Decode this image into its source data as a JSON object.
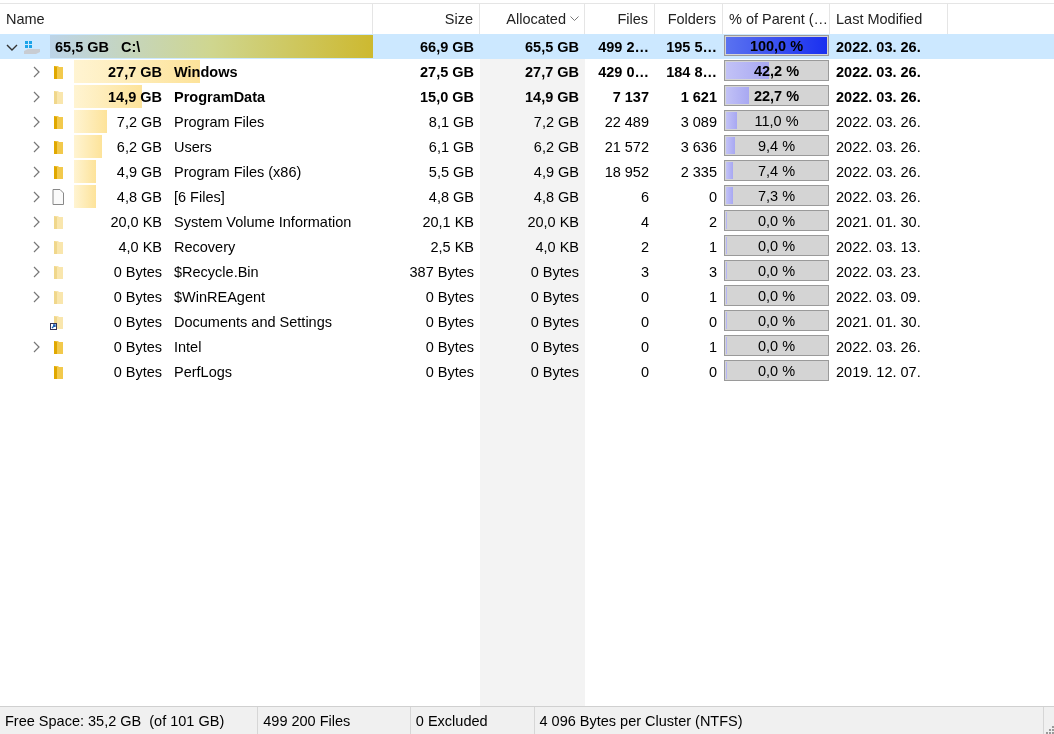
{
  "columns": [
    {
      "label": "Name",
      "sorted": false
    },
    {
      "label": "Size",
      "sorted": false
    },
    {
      "label": "Allocated",
      "sorted": true
    },
    {
      "label": "Files",
      "sorted": false
    },
    {
      "label": "Folders",
      "sorted": false
    },
    {
      "label": "% of Parent (…",
      "sorted": false
    },
    {
      "label": "Last Modified",
      "sorted": false
    }
  ],
  "tree": [
    {
      "kind": "drive",
      "name": "C:\\",
      "bar_label": "65,5 GB",
      "size": "66,9 GB",
      "allocated": "65,5 GB",
      "files": "499 2…",
      "folders": "195 5…",
      "percent": "100,0 %",
      "level": 1.0,
      "modified": "2022. 03. 26.",
      "bold": true,
      "hidden": false,
      "selected": true,
      "expandable": true,
      "expanded": true,
      "children": [
        {
          "kind": "folder",
          "name": "Windows",
          "bar_label": "27,7 GB",
          "size": "27,5 GB",
          "allocated": "27,7 GB",
          "files": "429 0…",
          "folders": "184 8…",
          "percent": "42,2 %",
          "level": 0.422,
          "modified": "2022. 03. 26.",
          "bold": true,
          "hidden": false,
          "selected": false,
          "expandable": true,
          "expanded": false
        },
        {
          "kind": "folder",
          "name": "ProgramData",
          "bar_label": "14,9 GB",
          "size": "15,0 GB",
          "allocated": "14,9 GB",
          "files": "7 137",
          "folders": "1 621",
          "percent": "22,7 %",
          "level": 0.227,
          "modified": "2022. 03. 26.",
          "bold": true,
          "hidden": true,
          "selected": false,
          "expandable": true,
          "expanded": false
        },
        {
          "kind": "folder",
          "name": "Program Files",
          "bar_label": "7,2 GB",
          "size": "8,1 GB",
          "allocated": "7,2 GB",
          "files": "22 489",
          "folders": "3 089",
          "percent": "11,0 %",
          "level": 0.11,
          "modified": "2022. 03. 26.",
          "bold": false,
          "hidden": false,
          "selected": false,
          "expandable": true,
          "expanded": false
        },
        {
          "kind": "folder",
          "name": "Users",
          "bar_label": "6,2 GB",
          "size": "6,1 GB",
          "allocated": "6,2 GB",
          "files": "21 572",
          "folders": "3 636",
          "percent": "9,4 %",
          "level": 0.094,
          "modified": "2022. 03. 26.",
          "bold": false,
          "hidden": false,
          "selected": false,
          "expandable": true,
          "expanded": false
        },
        {
          "kind": "folder",
          "name": "Program Files (x86)",
          "bar_label": "4,9 GB",
          "size": "5,5 GB",
          "allocated": "4,9 GB",
          "files": "18 952",
          "folders": "2 335",
          "percent": "7,4 %",
          "level": 0.074,
          "modified": "2022. 03. 26.",
          "bold": false,
          "hidden": false,
          "selected": false,
          "expandable": true,
          "expanded": false
        },
        {
          "kind": "file",
          "name": "[6 Files]",
          "bar_label": "4,8 GB",
          "size": "4,8 GB",
          "allocated": "4,8 GB",
          "files": "6",
          "folders": "0",
          "percent": "7,3 %",
          "level": 0.073,
          "modified": "2022. 03. 26.",
          "bold": false,
          "hidden": false,
          "selected": false,
          "expandable": true,
          "expanded": false
        },
        {
          "kind": "folder",
          "name": "System Volume Information",
          "bar_label": "20,0 KB",
          "size": "20,1 KB",
          "allocated": "20,0 KB",
          "files": "4",
          "folders": "2",
          "percent": "0,0 %",
          "level": 0.0,
          "modified": "2021. 01. 30.",
          "bold": false,
          "hidden": true,
          "selected": false,
          "expandable": true,
          "expanded": false
        },
        {
          "kind": "folder",
          "name": "Recovery",
          "bar_label": "4,0 KB",
          "size": "2,5 KB",
          "allocated": "4,0 KB",
          "files": "2",
          "folders": "1",
          "percent": "0,0 %",
          "level": 0.0,
          "modified": "2022. 03. 13.",
          "bold": false,
          "hidden": true,
          "selected": false,
          "expandable": true,
          "expanded": false
        },
        {
          "kind": "folder",
          "name": "$Recycle.Bin",
          "bar_label": "0 Bytes",
          "size": "387 Bytes",
          "allocated": "0 Bytes",
          "files": "3",
          "folders": "3",
          "percent": "0,0 %",
          "level": 0.0,
          "modified": "2022. 03. 23.",
          "bold": false,
          "hidden": true,
          "selected": false,
          "expandable": true,
          "expanded": false
        },
        {
          "kind": "folder",
          "name": "$WinREAgent",
          "bar_label": "0 Bytes",
          "size": "0 Bytes",
          "allocated": "0 Bytes",
          "files": "0",
          "folders": "1",
          "percent": "0,0 %",
          "level": 0.0,
          "modified": "2022. 03. 09.",
          "bold": false,
          "hidden": true,
          "selected": false,
          "expandable": true,
          "expanded": false
        },
        {
          "kind": "shortcut",
          "name": "Documents and Settings",
          "bar_label": "0 Bytes",
          "size": "0 Bytes",
          "allocated": "0 Bytes",
          "files": "0",
          "folders": "0",
          "percent": "0,0 %",
          "level": 0.0,
          "modified": "2021. 01. 30.",
          "bold": false,
          "hidden": true,
          "selected": false,
          "expandable": false,
          "expanded": false
        },
        {
          "kind": "folder",
          "name": "Intel",
          "bar_label": "0 Bytes",
          "size": "0 Bytes",
          "allocated": "0 Bytes",
          "files": "0",
          "folders": "1",
          "percent": "0,0 %",
          "level": 0.0,
          "modified": "2022. 03. 26.",
          "bold": false,
          "hidden": false,
          "selected": false,
          "expandable": true,
          "expanded": false
        },
        {
          "kind": "folder",
          "name": "PerfLogs",
          "bar_label": "0 Bytes",
          "size": "0 Bytes",
          "allocated": "0 Bytes",
          "files": "0",
          "folders": "0",
          "percent": "0,0 %",
          "level": 0.0,
          "modified": "2019. 12. 07.",
          "bold": false,
          "hidden": false,
          "selected": false,
          "expandable": false,
          "expanded": false
        }
      ]
    }
  ],
  "status_bar": [
    "Free Space: 35,2 GB  (of 101 GB)",
    "499 200 Files",
    "0 Excluded",
    "4 096 Bytes per Cluster (NTFS)"
  ]
}
